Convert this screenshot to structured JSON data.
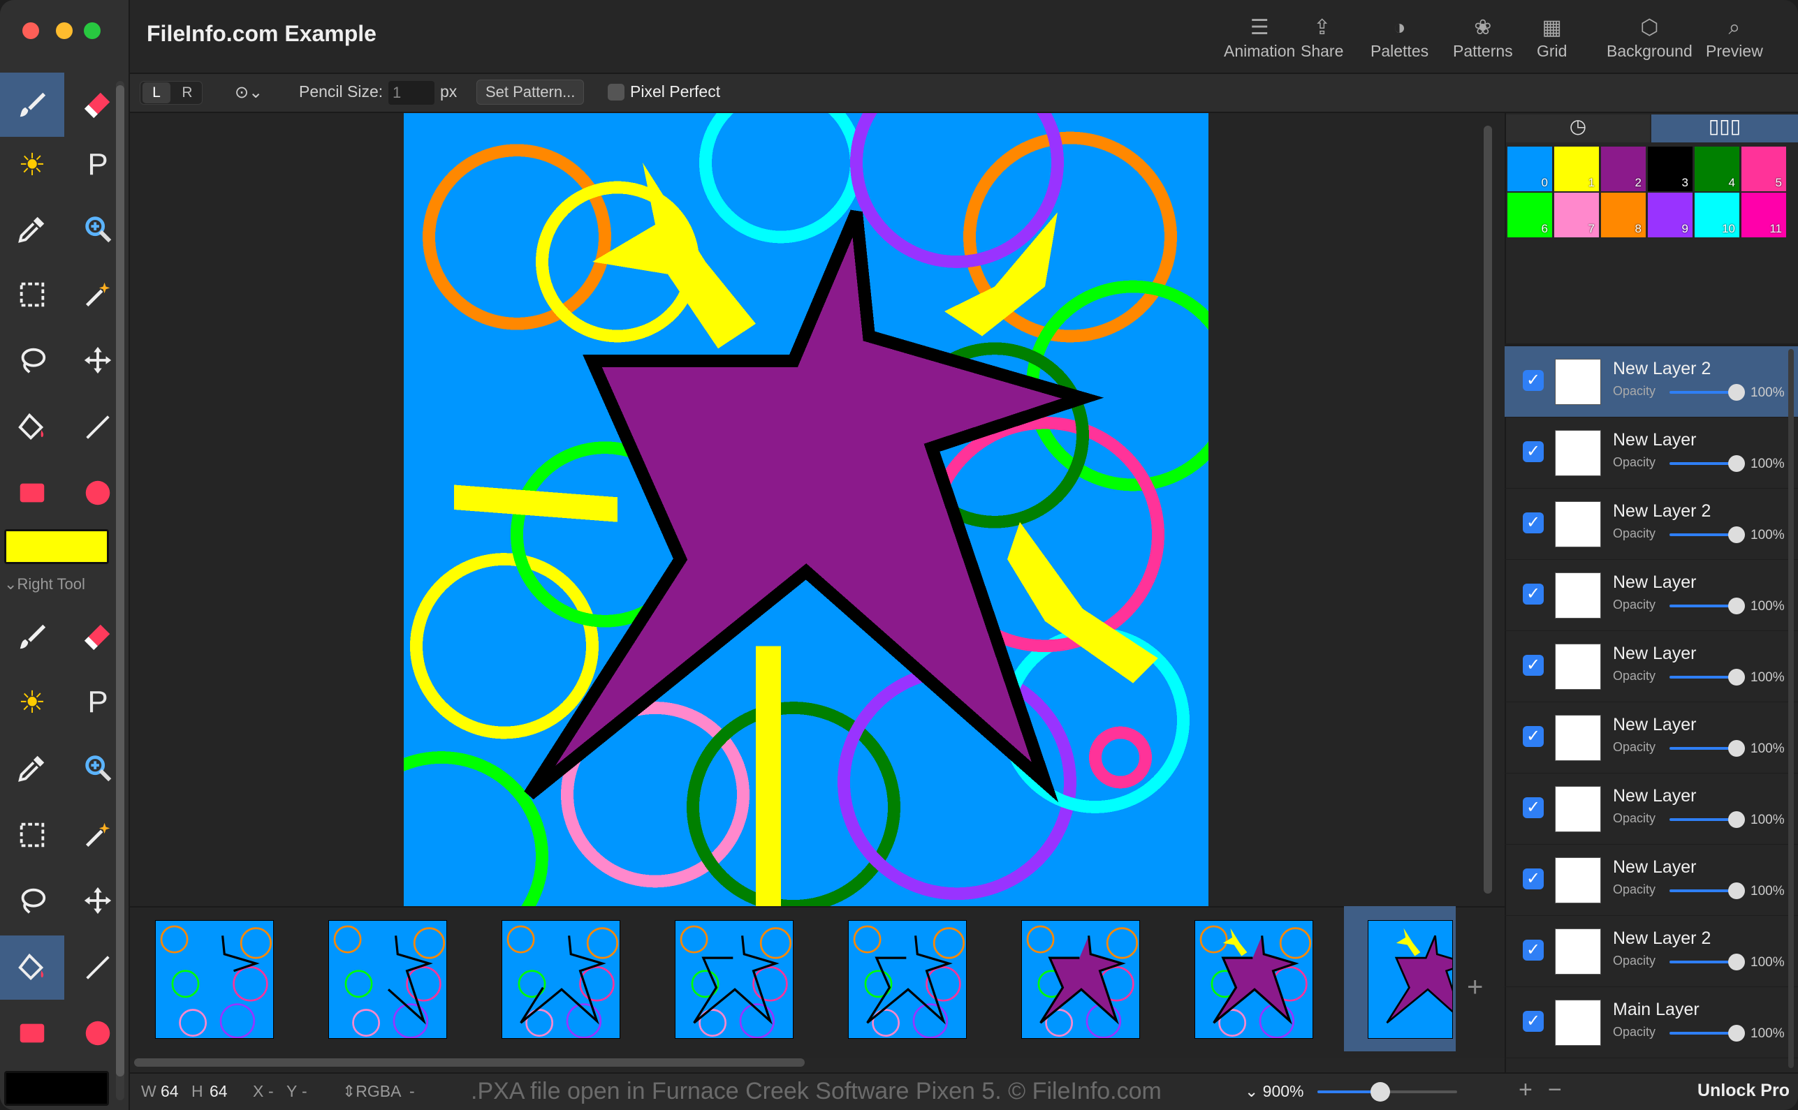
{
  "window": {
    "title": "FileInfo.com Example"
  },
  "header_buttons": [
    {
      "label": "Animation",
      "icon": "sliders-icon"
    },
    {
      "label": "Share",
      "icon": "share-icon"
    },
    {
      "label": "Palettes",
      "icon": "palette-icon"
    },
    {
      "label": "Patterns",
      "icon": "patterns-icon"
    },
    {
      "label": "Grid",
      "icon": "grid-icon"
    },
    {
      "label": "Background",
      "icon": "cube-icon"
    },
    {
      "label": "Preview",
      "icon": "magnifier-icon"
    }
  ],
  "options": {
    "left_btn": "L",
    "right_btn": "R",
    "pencil_size_label": "Pencil Size:",
    "pencil_size_value": "1",
    "pencil_size_unit": "px",
    "set_pattern": "Set Pattern...",
    "pixel_perfect": "Pixel Perfect"
  },
  "tools": {
    "left_color": "#ffff00",
    "right_color": "#000000",
    "right_tool_label": "Right Tool",
    "text_tool_glyph": "P"
  },
  "palette": {
    "colors": [
      "#0096ff",
      "#ffff00",
      "#8b1a8b",
      "#000000",
      "#008000",
      "#ff3399",
      "#00ff00",
      "#ff88cc",
      "#ff8800",
      "#9933ff",
      "#00ffff",
      "#ff00aa"
    ],
    "numbers": [
      "0",
      "1",
      "2",
      "3",
      "4",
      "5",
      "6",
      "7",
      "8",
      "9",
      "10",
      "11"
    ]
  },
  "layers": [
    {
      "name": "New Layer 2",
      "opacity_label": "Opacity",
      "opacity": "100%",
      "selected": true
    },
    {
      "name": "New Layer",
      "opacity_label": "Opacity",
      "opacity": "100%"
    },
    {
      "name": "New Layer 2",
      "opacity_label": "Opacity",
      "opacity": "100%"
    },
    {
      "name": "New Layer",
      "opacity_label": "Opacity",
      "opacity": "100%"
    },
    {
      "name": "New Layer",
      "opacity_label": "Opacity",
      "opacity": "100%"
    },
    {
      "name": "New Layer",
      "opacity_label": "Opacity",
      "opacity": "100%"
    },
    {
      "name": "New Layer",
      "opacity_label": "Opacity",
      "opacity": "100%"
    },
    {
      "name": "New Layer",
      "opacity_label": "Opacity",
      "opacity": "100%"
    },
    {
      "name": "New Layer 2",
      "opacity_label": "Opacity",
      "opacity": "100%"
    },
    {
      "name": "Main Layer",
      "opacity_label": "Opacity",
      "opacity": "100%"
    }
  ],
  "status": {
    "w_label": "W",
    "w_value": "64",
    "h_label": "H",
    "h_value": "64",
    "x_label": "X",
    "x_value": "-",
    "y_label": "Y",
    "y_value": "-",
    "color_mode": "RGBA",
    "color_value": "-",
    "watermark": ".PXA file open in Furnace Creek Software Pixen 5. © FileInfo.com",
    "zoom": "900%",
    "zoom_level": 0.45,
    "add": "+",
    "remove": "−",
    "unlock": "Unlock Pro"
  },
  "filmstrip": {
    "add": "+",
    "frame_count": 8
  }
}
